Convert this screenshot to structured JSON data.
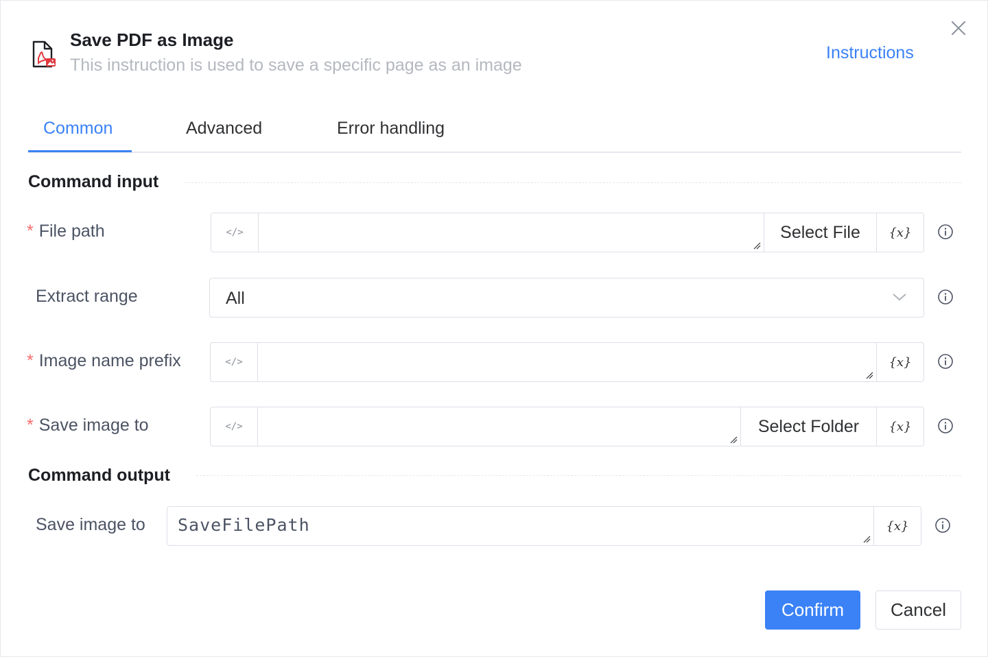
{
  "header": {
    "title": "Save PDF as Image",
    "subtitle": "This instruction is used to save a specific page as an image",
    "instructions_link": "Instructions",
    "icon": "pdf-image-icon",
    "close_icon": "close-icon"
  },
  "tabs": [
    {
      "label": "Common",
      "active": true
    },
    {
      "label": "Advanced",
      "active": false
    },
    {
      "label": "Error handling",
      "active": false
    }
  ],
  "sections": {
    "input_title": "Command input",
    "output_title": "Command output"
  },
  "fields": {
    "file_path": {
      "label": "File path",
      "required": "*",
      "value": "",
      "button": "Select File",
      "var_label": "{x}",
      "code_label": "</>"
    },
    "extract_range": {
      "label": "Extract range",
      "value": "All"
    },
    "image_prefix": {
      "label": "Image name prefix",
      "required": "*",
      "value": "",
      "var_label": "{x}",
      "code_label": "</>"
    },
    "save_image_to": {
      "label": "Save image to",
      "required": "*",
      "value": "",
      "button": "Select Folder",
      "var_label": "{x}",
      "code_label": "</>"
    },
    "output_save_to": {
      "label": "Save image to",
      "value": "SaveFilePath",
      "var_label": "{x}"
    }
  },
  "footer": {
    "confirm": "Confirm",
    "cancel": "Cancel"
  },
  "colors": {
    "accent": "#3b82f6",
    "required": "#f56c6c",
    "pdf_red": "#e0393e"
  }
}
